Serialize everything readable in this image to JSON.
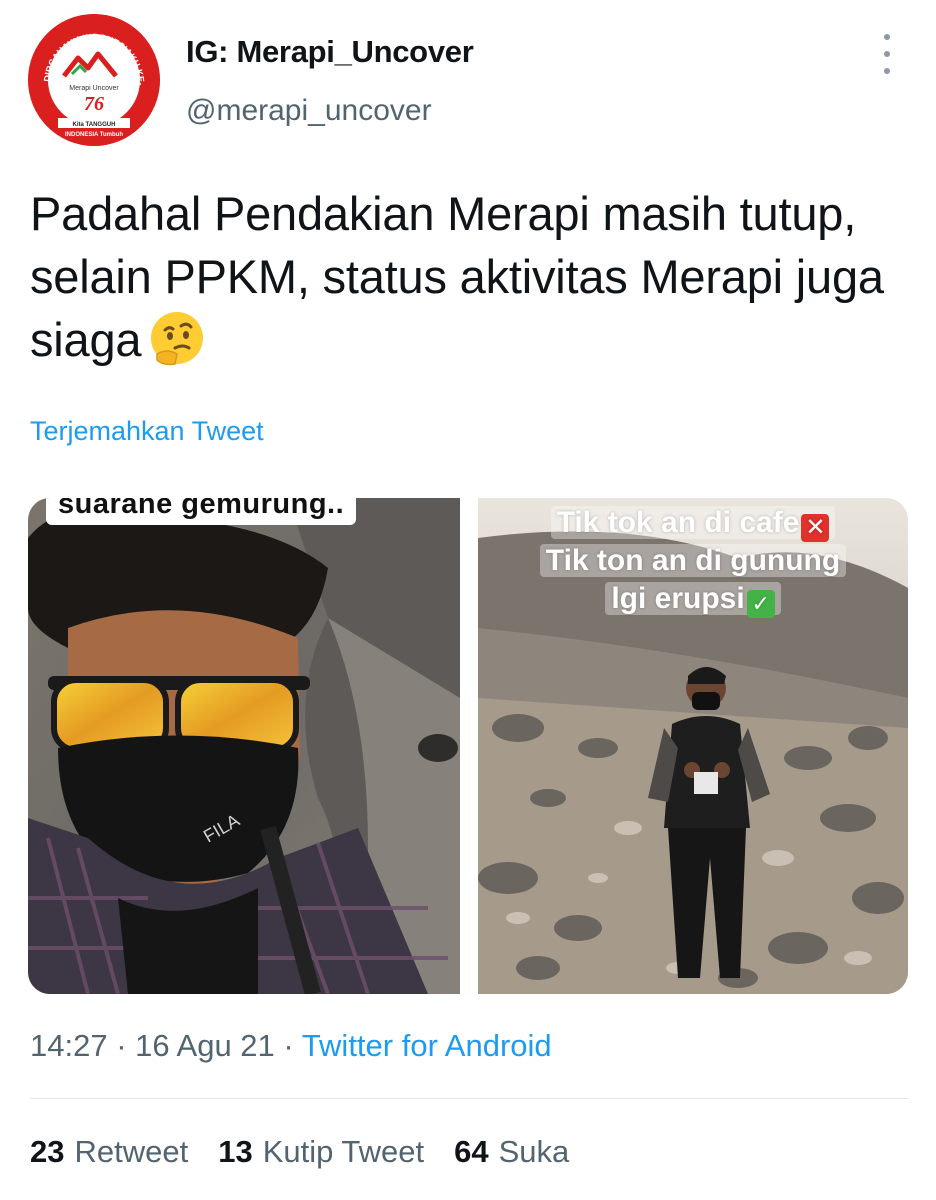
{
  "tweet": {
    "display_name": "IG: Merapi_Uncover",
    "handle": "@merapi_uncover",
    "more_icon": "more-vertical-icon",
    "text": "Padahal Pendakian Merapi masih tutup, selain PPKM, status aktivitas Merapi juga siaga",
    "emoji": "thinking-face-emoji",
    "translate_label": "Terjemahkan Tweet",
    "avatar": {
      "ring_text": "DIRGAHAYU INDONESIAKU KE-76",
      "name": "Merapi Uncover",
      "number": "76",
      "banner_line1": "Kita TANGGUH",
      "banner_line2": "INDONESIA Tumbuh"
    },
    "media": {
      "left_caption": "suarane gemurung..",
      "right_caption_line1": "Tik tok an di cafe",
      "right_caption_line2": "Tik ton an di gunung",
      "right_caption_line3": "lgi erupsi",
      "cross_mark": "✕",
      "check_mark": "✓"
    },
    "time": "14:27",
    "date": "16 Agu 21",
    "separator": "·",
    "source": "Twitter for Android",
    "stats": {
      "retweet_count": "23",
      "retweet_label": "Retweet",
      "quote_count": "13",
      "quote_label": "Kutip Tweet",
      "like_count": "64",
      "like_label": "Suka"
    }
  },
  "colors": {
    "link_blue": "#1d9bf0",
    "secondary_text": "#536471",
    "avatar_red": "#d9201f"
  }
}
